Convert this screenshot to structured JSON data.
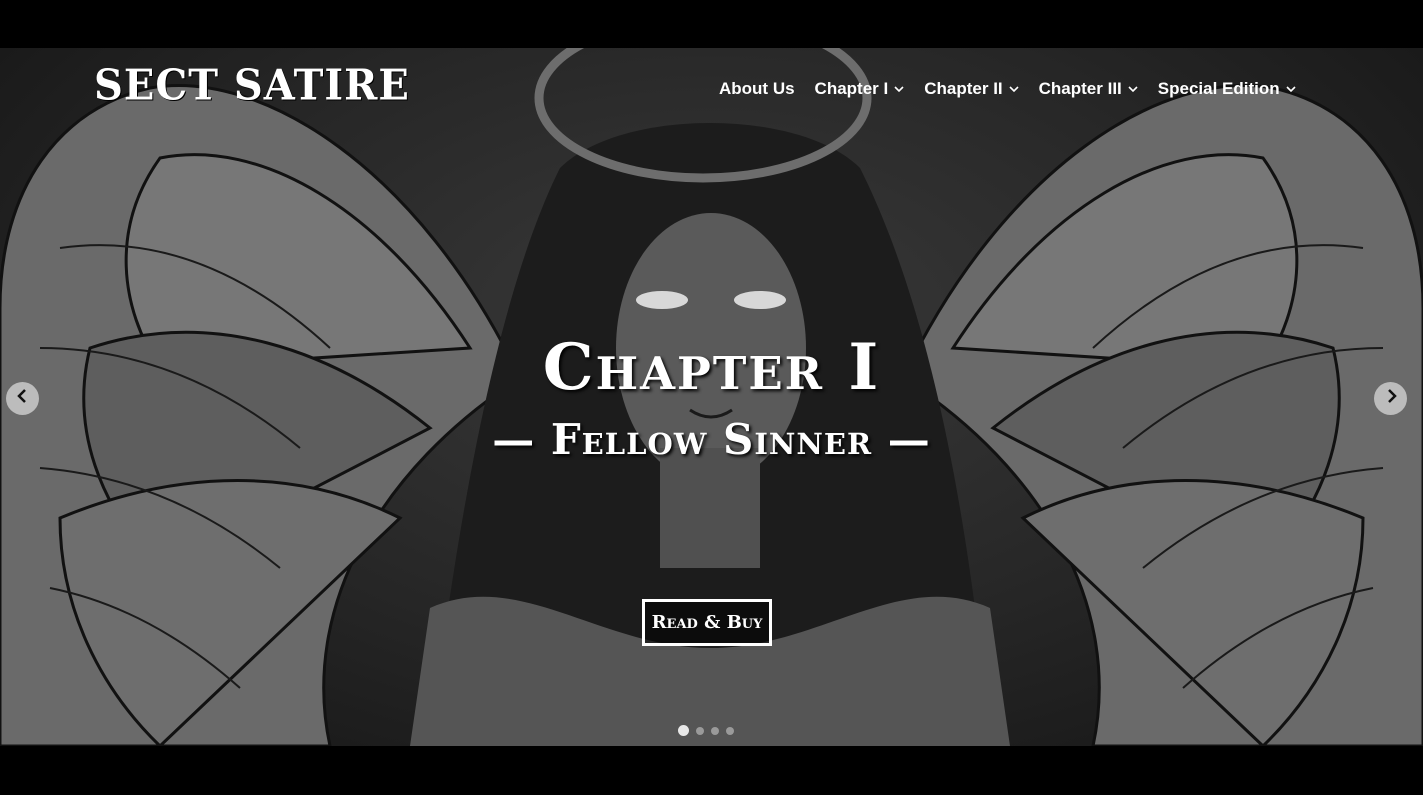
{
  "header": {
    "logo_text": "SECT SATIRE",
    "nav": [
      {
        "label": "About Us",
        "has_dropdown": false
      },
      {
        "label": "Chapter I",
        "has_dropdown": true
      },
      {
        "label": "Chapter II",
        "has_dropdown": true
      },
      {
        "label": "Chapter III",
        "has_dropdown": true
      },
      {
        "label": "Special Edition",
        "has_dropdown": true
      }
    ]
  },
  "hero": {
    "title": "Chapter I",
    "subtitle": "— Fellow Sinner —",
    "cta_label": "Read & Buy",
    "slides_total": 4,
    "active_slide": 1,
    "prev_icon": "chevron-left-icon",
    "next_icon": "chevron-right-icon",
    "background_image": "angel-with-wings-and-halo illustration"
  },
  "colors": {
    "background": "#000000",
    "text": "#ffffff",
    "hero_tint": "#2a2a2a"
  }
}
